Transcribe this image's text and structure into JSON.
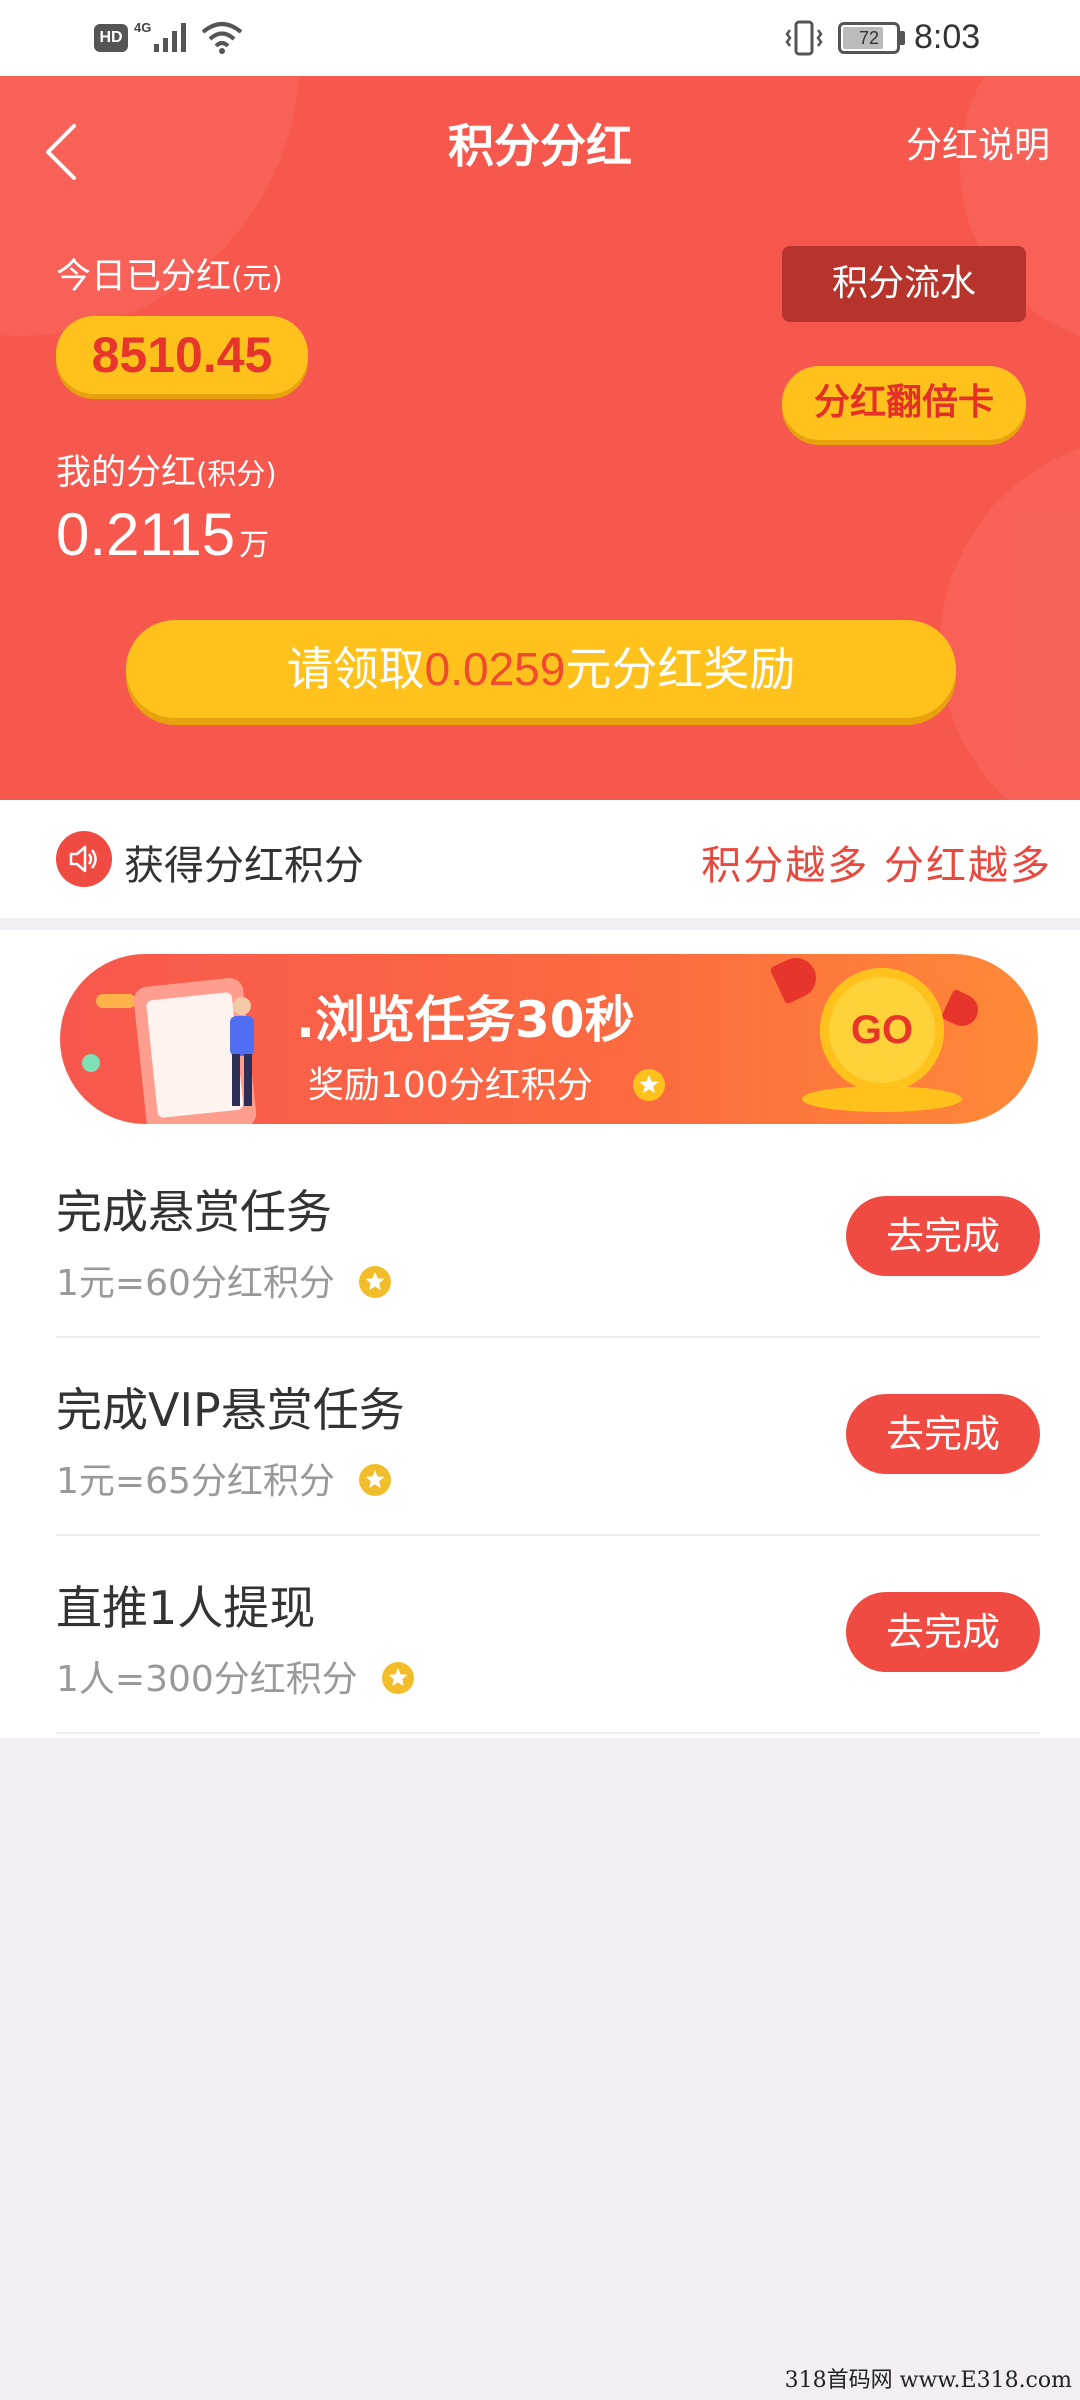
{
  "status_bar": {
    "hd": "HD",
    "network": "4G",
    "battery": "72",
    "time": "8:03"
  },
  "header": {
    "title": "积分分红",
    "explain_link": "分红说明"
  },
  "summary": {
    "today_label": "今日已分红",
    "today_unit": "(元)",
    "today_amount": "8510.45",
    "my_label": "我的分红",
    "my_unit_label": "(积分)",
    "my_value": "0.2115",
    "my_value_unit": "万",
    "flow_button": "积分流水",
    "double_card_button": "分红翻倍卡"
  },
  "claim": {
    "prefix": "请领取",
    "amount": "0.0259",
    "suffix": "元分红奖励"
  },
  "notice": {
    "title": "获得分红积分",
    "slogan": "积分越多 分红越多"
  },
  "banner": {
    "title": ".浏览任务30秒",
    "subtitle": "奖励100分红积分",
    "go_label": "GO"
  },
  "tasks": [
    {
      "title": "完成悬赏任务",
      "reward": "1元=60分红积分",
      "button": "去完成"
    },
    {
      "title": "完成VIP悬赏任务",
      "reward": "1元=65分红积分",
      "button": "去完成"
    },
    {
      "title": "直推1人提现",
      "reward": "1人=300分红积分",
      "button": "去完成"
    }
  ],
  "watermark": "318首码网 www.E318.com",
  "colors": {
    "primary_red": "#f7584e",
    "accent_yellow": "#ffc21c",
    "button_red": "#f04b43",
    "dark_red": "#b7342d"
  },
  "icons": [
    "back-arrow-icon",
    "speaker-icon",
    "star-coin-icon",
    "go-coin-icon",
    "signal-icon",
    "wifi-icon",
    "vibrate-icon",
    "battery-icon"
  ]
}
